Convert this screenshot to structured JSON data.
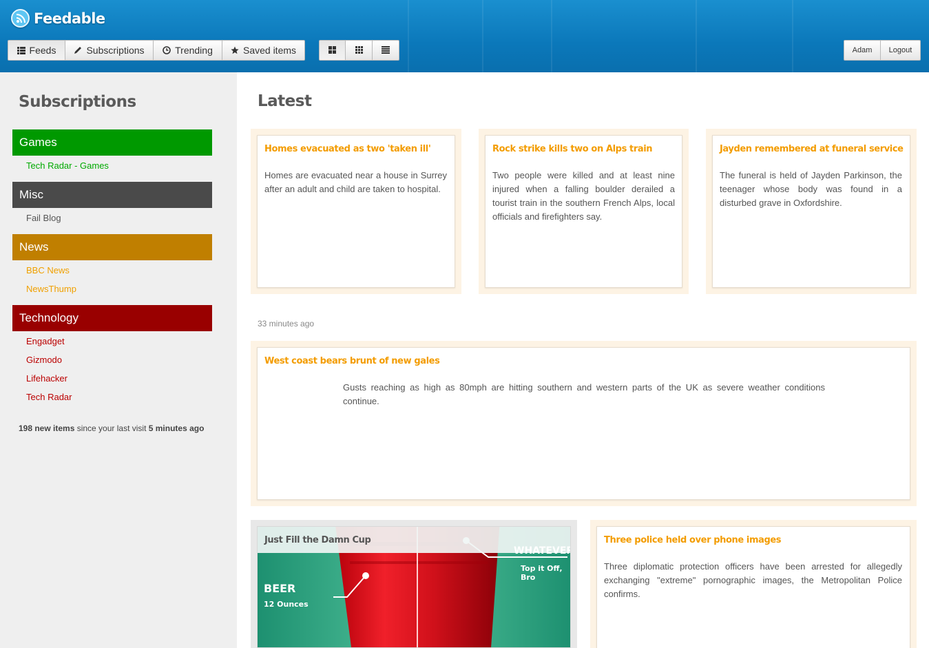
{
  "app": {
    "name": "Feedable"
  },
  "nav": {
    "feeds": "Feeds",
    "subscriptions": "Subscriptions",
    "trending": "Trending",
    "saved": "Saved items"
  },
  "view_modes": [
    "grid-large-icon",
    "grid-small-icon",
    "list-icon"
  ],
  "user": {
    "name": "Adam",
    "logout": "Logout"
  },
  "sidebar": {
    "title": "Subscriptions",
    "categories": [
      {
        "name": "Games",
        "color": "#009900",
        "feeds": [
          "Tech Radar - Games"
        ]
      },
      {
        "name": "Misc",
        "color": "#4a4a4a",
        "feeds": [
          "Fail Blog"
        ]
      },
      {
        "name": "News",
        "color": "#c07f00",
        "feeds": [
          "BBC News",
          "NewsThump"
        ]
      },
      {
        "name": "Technology",
        "color": "#990000",
        "feeds": [
          "Engadget",
          "Gizmodo",
          "Lifehacker",
          "Tech Radar"
        ]
      }
    ],
    "feed_colors": {
      "games": "#00aa00",
      "misc": "#555555",
      "news": "#f0a000",
      "tech": "#bb0000"
    },
    "stats": {
      "count": "198 new items",
      "middle": " since your last visit ",
      "time": "5 minutes ago"
    }
  },
  "main": {
    "title": "Latest",
    "timestamp": "33 minutes ago",
    "articles": [
      {
        "title": "Homes evacuated as two 'taken ill'",
        "body": "Homes are evacuated near a house in Surrey after an adult and child are taken to hospital."
      },
      {
        "title": "Rock strike kills two on Alps train",
        "body": "Two people were killed and at least nine injured when a falling boulder derailed a tourist train in the southern French Alps, local officials and firefighters say."
      },
      {
        "title": "Jayden remembered at funeral service",
        "body": "The funeral is held of Jayden Parkinson, the teenager whose body was found in a disturbed grave in Oxfordshire."
      },
      {
        "title": "West coast bears brunt of new gales",
        "body": "Gusts reaching as high as 80mph are hitting southern and western parts of the UK as severe weather conditions continue."
      },
      {
        "title": "Just Fill the Damn Cup",
        "image_labels": {
          "beer": "BEER",
          "beer_sub": "12 Ounces",
          "whatever": "WHATEVER",
          "whatever_sub": "Top it Off, Bro"
        }
      },
      {
        "title": "Three police held over phone images",
        "body": "Three diplomatic protection officers have been arrested for allegedly exchanging \"extreme\" pornographic images, the Metropolitan Police confirms."
      }
    ]
  },
  "colors": {
    "header": "#0b78ba",
    "accent_title": "#f39c00",
    "card_bg": "#fdf3e4",
    "sidebar_bg": "#efefef"
  }
}
